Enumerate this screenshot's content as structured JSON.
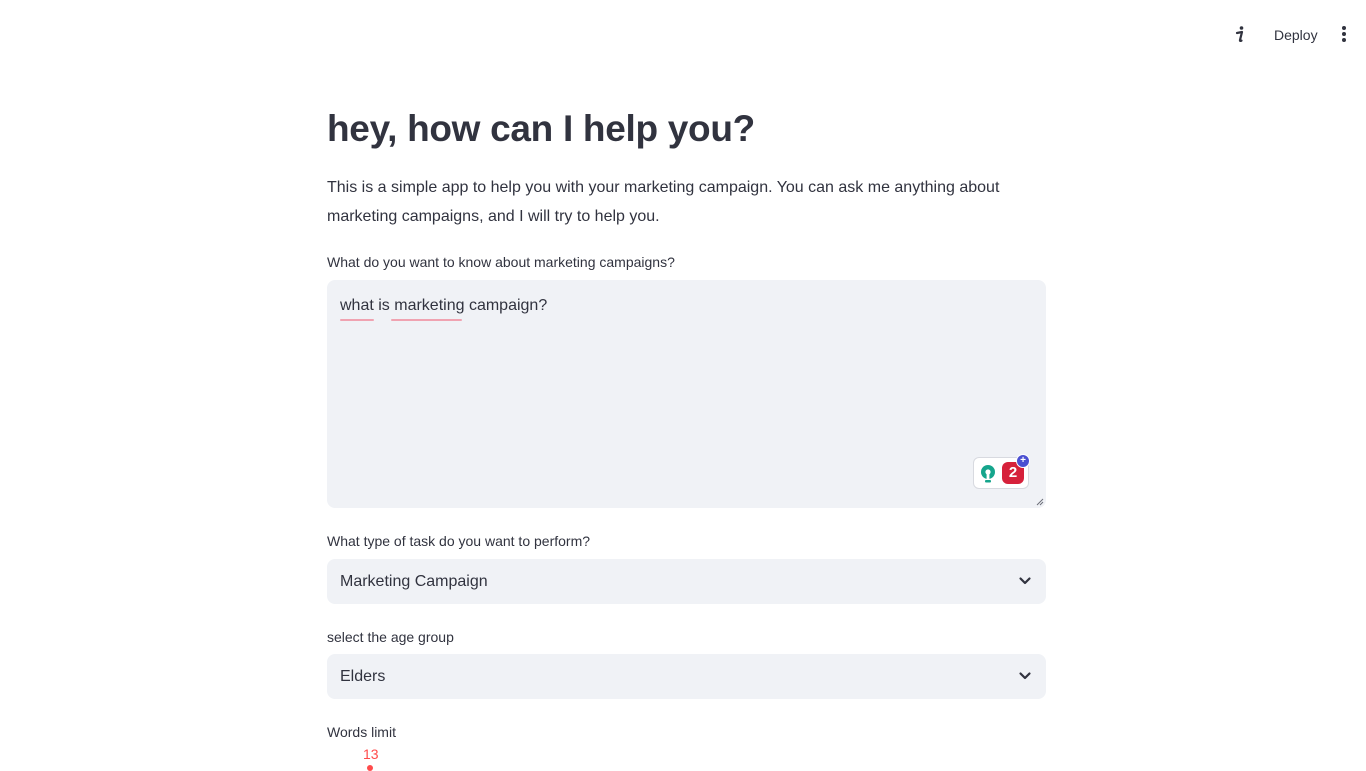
{
  "header": {
    "deploy_label": "Deploy"
  },
  "main": {
    "title": "hey, how can I help you?",
    "intro": "This is a simple app to help you with your marketing campaign. You can ask me anything about marketing campaigns, and I will try to help you.",
    "question": {
      "label": "What do you want to know about marketing campaigns?",
      "value": "what is marketing campaign?"
    },
    "grammar_widget": {
      "count": "2",
      "plus": "+"
    },
    "task": {
      "label": "What type of task do you want to perform?",
      "selected": "Marketing Campaign"
    },
    "age_group": {
      "label": "select the age group",
      "selected": "Elders"
    },
    "words_limit": {
      "label": "Words limit",
      "value": "13"
    }
  },
  "colors": {
    "accent": "#ff4b4b",
    "input_bg": "#f0f2f6",
    "text": "#31333f"
  },
  "icons": [
    "info-icon",
    "more-vertical-icon",
    "chevron-down-icon",
    "lightbulb-icon",
    "resize-handle-icon"
  ]
}
